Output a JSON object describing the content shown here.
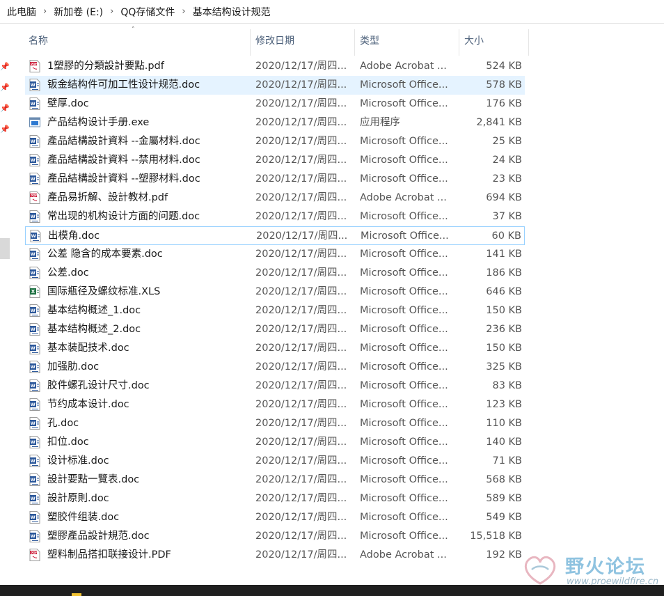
{
  "breadcrumb": [
    "此电脑",
    "新加卷 (E:)",
    "QQ存储文件",
    "基本结构设计规范"
  ],
  "columns": {
    "name": "名称",
    "date": "修改日期",
    "type": "类型",
    "size": "大小"
  },
  "files": [
    {
      "name": "1塑膠的分類設計要點.pdf",
      "date": "2020/12/17/周四...",
      "type": "Adobe Acrobat ...",
      "size": "524 KB",
      "icon": "pdf-file-icon"
    },
    {
      "name": "钣金结构件可加工性设计规范.doc",
      "date": "2020/12/17/周四...",
      "type": "Microsoft Office...",
      "size": "578 KB",
      "icon": "word-file-icon"
    },
    {
      "name": "壁厚.doc",
      "date": "2020/12/17/周四...",
      "type": "Microsoft Office...",
      "size": "176 KB",
      "icon": "word-file-icon"
    },
    {
      "name": "产品结构设计手册.exe",
      "date": "2020/12/17/周四...",
      "type": "应用程序",
      "size": "2,841 KB",
      "icon": "exe-file-icon"
    },
    {
      "name": "產品結構設計資料 --金屬材料.doc",
      "date": "2020/12/17/周四...",
      "type": "Microsoft Office...",
      "size": "25 KB",
      "icon": "word-file-icon"
    },
    {
      "name": "產品結構設計資料 --禁用材料.doc",
      "date": "2020/12/17/周四...",
      "type": "Microsoft Office...",
      "size": "24 KB",
      "icon": "word-file-icon"
    },
    {
      "name": "產品結構設計資料 --塑膠材料.doc",
      "date": "2020/12/17/周四...",
      "type": "Microsoft Office...",
      "size": "23 KB",
      "icon": "word-file-icon"
    },
    {
      "name": "產品易折解、設計教材.pdf",
      "date": "2020/12/17/周四...",
      "type": "Adobe Acrobat ...",
      "size": "694 KB",
      "icon": "pdf-file-icon"
    },
    {
      "name": "常出现的机构设计方面的问题.doc",
      "date": "2020/12/17/周四...",
      "type": "Microsoft Office...",
      "size": "37 KB",
      "icon": "word-file-icon"
    },
    {
      "name": "出模角.doc",
      "date": "2020/12/17/周四...",
      "type": "Microsoft Office...",
      "size": "60 KB",
      "icon": "word-file-icon"
    },
    {
      "name": "公差 隐含的成本要素.doc",
      "date": "2020/12/17/周四...",
      "type": "Microsoft Office...",
      "size": "141 KB",
      "icon": "word-file-icon"
    },
    {
      "name": "公差.doc",
      "date": "2020/12/17/周四...",
      "type": "Microsoft Office...",
      "size": "186 KB",
      "icon": "word-file-icon"
    },
    {
      "name": "国际瓶径及螺纹标准.XLS",
      "date": "2020/12/17/周四...",
      "type": "Microsoft Office...",
      "size": "646 KB",
      "icon": "excel-file-icon"
    },
    {
      "name": "基本结构概述_1.doc",
      "date": "2020/12/17/周四...",
      "type": "Microsoft Office...",
      "size": "150 KB",
      "icon": "word-file-icon"
    },
    {
      "name": "基本结构概述_2.doc",
      "date": "2020/12/17/周四...",
      "type": "Microsoft Office...",
      "size": "236 KB",
      "icon": "word-file-icon"
    },
    {
      "name": "基本装配技术.doc",
      "date": "2020/12/17/周四...",
      "type": "Microsoft Office...",
      "size": "150 KB",
      "icon": "word-file-icon"
    },
    {
      "name": "加强肋.doc",
      "date": "2020/12/17/周四...",
      "type": "Microsoft Office...",
      "size": "325 KB",
      "icon": "word-file-icon"
    },
    {
      "name": "胶件螺孔设计尺寸.doc",
      "date": "2020/12/17/周四...",
      "type": "Microsoft Office...",
      "size": "83 KB",
      "icon": "word-file-icon"
    },
    {
      "name": "节约成本设计.doc",
      "date": "2020/12/17/周四...",
      "type": "Microsoft Office...",
      "size": "123 KB",
      "icon": "word-file-icon"
    },
    {
      "name": "孔.doc",
      "date": "2020/12/17/周四...",
      "type": "Microsoft Office...",
      "size": "110 KB",
      "icon": "word-file-icon"
    },
    {
      "name": "扣位.doc",
      "date": "2020/12/17/周四...",
      "type": "Microsoft Office...",
      "size": "140 KB",
      "icon": "word-file-icon"
    },
    {
      "name": "设计标准.doc",
      "date": "2020/12/17/周四...",
      "type": "Microsoft Office...",
      "size": "71 KB",
      "icon": "word-file-icon"
    },
    {
      "name": "設計要點一覽表.doc",
      "date": "2020/12/17/周四...",
      "type": "Microsoft Office...",
      "size": "568 KB",
      "icon": "word-file-icon"
    },
    {
      "name": "設計原則.doc",
      "date": "2020/12/17/周四...",
      "type": "Microsoft Office...",
      "size": "589 KB",
      "icon": "word-file-icon"
    },
    {
      "name": "塑胶件组装.doc",
      "date": "2020/12/17/周四...",
      "type": "Microsoft Office...",
      "size": "549 KB",
      "icon": "word-file-icon"
    },
    {
      "name": "塑膠產品設計規范.doc",
      "date": "2020/12/17/周四...",
      "type": "Microsoft Office...",
      "size": "15,518 KB",
      "icon": "word-file-icon"
    },
    {
      "name": "塑料制品搭扣联接设计.PDF",
      "date": "2020/12/17/周四...",
      "type": "Adobe Acrobat ...",
      "size": "192 KB",
      "icon": "pdf-file-icon"
    }
  ],
  "selected_index": 1,
  "focused_index": 9,
  "watermark": {
    "text": "野火论坛",
    "url": "www.proewildfire.cn"
  },
  "colors": {
    "selection": "#e5f3ff",
    "focus_border": "#99d1ff",
    "header_text": "#4c607a"
  }
}
